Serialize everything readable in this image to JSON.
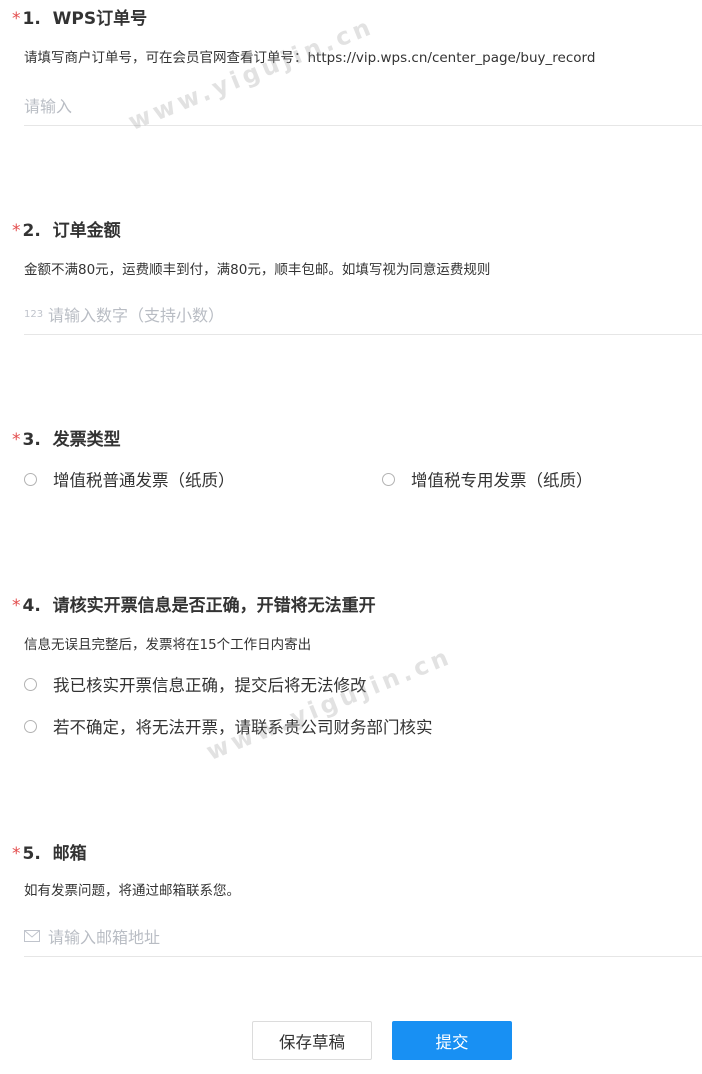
{
  "q1": {
    "required_mark": "*",
    "number": "1.",
    "title": "WPS订单号",
    "description": "请填写商户订单号，可在会员官网查看订单号：https://vip.wps.cn/center_page/buy_record",
    "placeholder": "请输入"
  },
  "q2": {
    "required_mark": "*",
    "number": "2.",
    "title": "订单金额",
    "description": "金额不满80元，运费顺丰到付，满80元，顺丰包邮。如填写视为同意运费规则",
    "number_icon_text": "123",
    "placeholder": "请输入数字（支持小数）"
  },
  "q3": {
    "required_mark": "*",
    "number": "3.",
    "title": "发票类型",
    "options": [
      "增值税普通发票（纸质）",
      "增值税专用发票（纸质）"
    ]
  },
  "q4": {
    "required_mark": "*",
    "number": "4.",
    "title": "请核实开票信息是否正确，开错将无法重开",
    "description": "信息无误且完整后，发票将在15个工作日内寄出",
    "options": [
      "我已核实开票信息正确，提交后将无法修改",
      "若不确定，将无法开票，请联系贵公司财务部门核实"
    ]
  },
  "q5": {
    "required_mark": "*",
    "number": "5.",
    "title": "邮箱",
    "description": "如有发票问题，将通过邮箱联系您。",
    "placeholder": "请输入邮箱地址"
  },
  "buttons": {
    "save_draft": "保存草稿",
    "submit": "提交"
  },
  "watermark": "www.yigujin.cn",
  "colors": {
    "accent": "#1890f3",
    "required": "#e34d4d"
  },
  "icons": {
    "number_field": "number-123-icon",
    "email_field": "envelope-icon",
    "radio": "radio-unchecked-icon"
  }
}
